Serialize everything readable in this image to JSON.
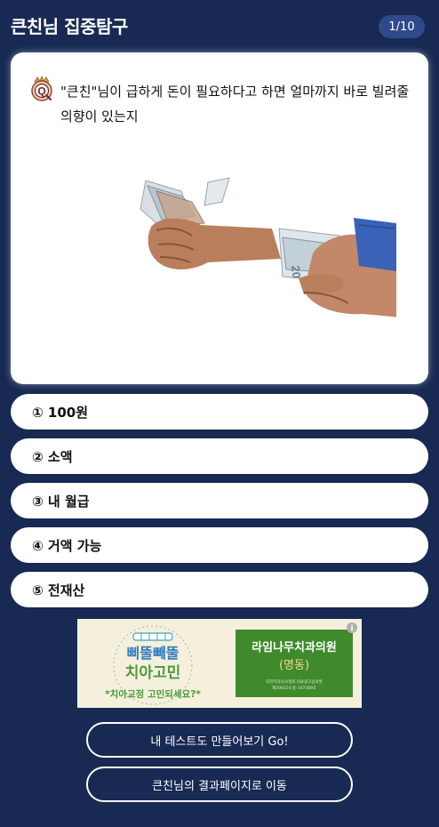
{
  "header": {
    "title": "큰친님 집중탐구",
    "progress": "1/10"
  },
  "question": {
    "icon": "q-badge-icon",
    "text": "\"큰친\"님이 급하게 돈이 필요하다고 하면 얼마까지 바로 빌려줄 의향이 있는지"
  },
  "options": [
    {
      "label": "① 100원"
    },
    {
      "label": "② 소액"
    },
    {
      "label": "③ 내 월급"
    },
    {
      "label": "④ 거액 가능"
    },
    {
      "label": "⑤ 전재산"
    }
  ],
  "ad": {
    "brand_line1": "삐뚤빼뚤",
    "brand_line2": "치아고민",
    "tagline": "*치아교정 고민되세요?*",
    "clinic_name": "라임나무치과의원",
    "clinic_branch": "(명동)",
    "fine_print_1": "대한치과의사협회 의료광고심의필",
    "fine_print_2": "제200224-중-147489호",
    "info_icon": "i"
  },
  "actions": {
    "make_test": "내 테스트도 만들어보기 Go!",
    "result_page": "큰친님의 결과페이지로 이동"
  },
  "colors": {
    "background": "#182a53",
    "progress_pill": "#2e4a8a",
    "ad_green": "#3f8a2c"
  }
}
